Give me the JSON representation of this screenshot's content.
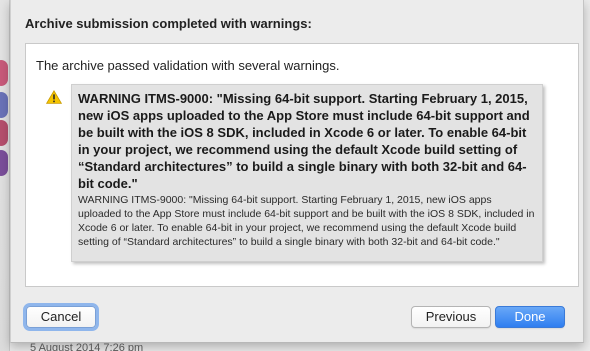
{
  "sheet": {
    "title": "Archive submission completed with warnings:",
    "message": "The archive passed validation with several warnings.",
    "warning": {
      "icon": "warning-triangle-icon",
      "headline": "WARNING ITMS-9000: \"Missing 64-bit support. Starting February 1, 2015, new iOS apps uploaded to the App Store must include 64-bit support and be built with the iOS 8 SDK, included in Xcode 6 or later. To enable 64-bit in your project, we recommend using the default Xcode build setting of “Standard architectures” to build a single binary with both 32-bit and 64-bit code.\"",
      "detail": "WARNING ITMS-9000: \"Missing 64-bit support. Starting February 1, 2015, new iOS apps uploaded to the App Store must include 64-bit support and be built with the iOS 8 SDK, included in Xcode 6 or later. To enable 64-bit in your project, we recommend using the default Xcode build setting of “Standard architectures” to build a single binary with both 32-bit and 64-bit code.\""
    },
    "buttons": {
      "cancel": "Cancel",
      "previous": "Previous",
      "done": "Done"
    }
  },
  "background": {
    "peek_text": "5 August 2014 7:26 pm"
  },
  "colors": {
    "done_button": "#2f7ef0",
    "focus_ring": "#8fb6ec",
    "warning_yellow": "#f5c400"
  }
}
